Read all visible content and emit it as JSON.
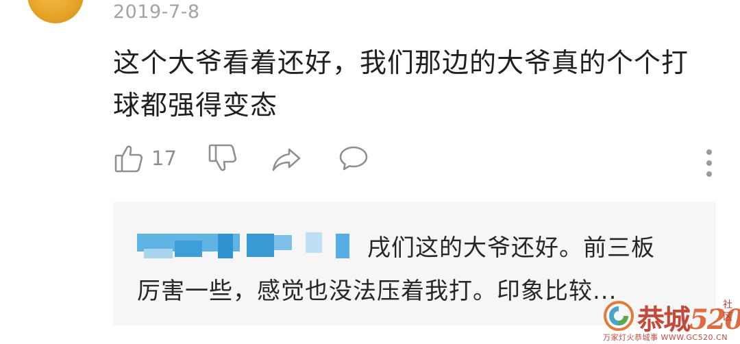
{
  "comment": {
    "date": "2019-7-8",
    "text": "这个大爷看着还好，我们那边的大爷真的个个打球都强得变态",
    "text_line1": "这个大爷看着还好，我们那边的大爷真的个个打",
    "text_line2": "球都强得变态"
  },
  "actions": {
    "like_icon": "thumbs-up-icon",
    "like_count": "17",
    "dislike_icon": "thumbs-down-icon",
    "share_icon": "share-icon",
    "reply_icon": "comment-bubble-icon",
    "more_icon": "more-vertical-icon"
  },
  "reply": {
    "line1": "戌们这的大爷还好。前三板",
    "line2": "厉害一些，感觉也没法压着我打。印象比较..."
  },
  "watermark": {
    "main_text": "恭城",
    "number_text": "520",
    "side_text": "社区",
    "sub_text": "万家灯火恭城事 WWW.GC520.CN"
  },
  "colors": {
    "date_gray": "#a3a3a3",
    "icon_gray": "#8f8f8f",
    "reply_bg": "#f6f6f6",
    "blur_blue": "#4aa8dd",
    "watermark_red": "#c24a3a"
  }
}
